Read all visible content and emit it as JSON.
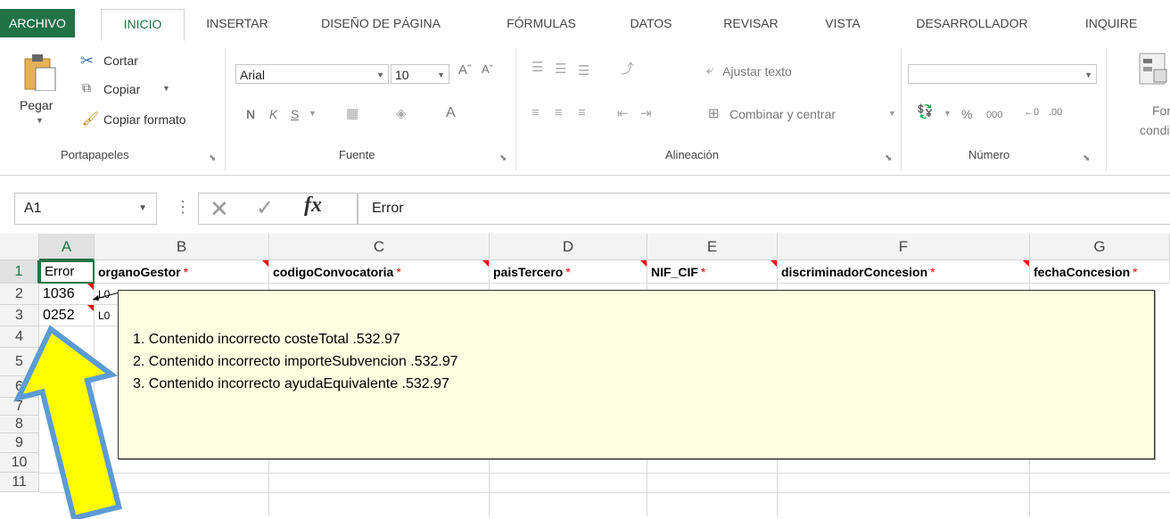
{
  "tabs": [
    "ARCHIVO",
    "INICIO",
    "INSERTAR",
    "DISEÑO DE PÁGINA",
    "FÓRMULAS",
    "DATOS",
    "REVISAR",
    "VISTA",
    "DESARROLLADOR",
    "INQUIRE"
  ],
  "clipboard": {
    "paste_label": "Pegar",
    "cut_label": "Cortar",
    "copy_label": "Copiar",
    "format_painter_label": "Copiar formato",
    "group_label": "Portapapeles"
  },
  "font": {
    "family_value": "Arial",
    "size_value": "10",
    "bold_label": "N",
    "italic_label": "K",
    "underline_label": "S",
    "group_label": "Fuente"
  },
  "alignment": {
    "wrap_text_label": "Ajustar texto",
    "merge_center_label": "Combinar y centrar",
    "group_label": "Alineación"
  },
  "number": {
    "format_value": "",
    "percent_label": "%",
    "thousands_label": "000",
    "group_label": "Número"
  },
  "styles": {
    "conditional_format_label_1": "Forma",
    "conditional_format_label_2": "condicio"
  },
  "formula_bar": {
    "name_box": "A1",
    "content": "Error"
  },
  "columns": [
    "A",
    "B",
    "C",
    "D",
    "E",
    "F",
    "G"
  ],
  "rows": [
    "1",
    "2",
    "3",
    "4",
    "5",
    "6",
    "7",
    "8",
    "9",
    "10",
    "11"
  ],
  "header_row": [
    "Error",
    "organoGestor",
    "codigoConvocatoria",
    "paisTercero",
    "NIF_CIF",
    "discriminadorConcesion",
    "fechaConcesion"
  ],
  "required_marker": "*",
  "data_rows": [
    [
      "1036",
      "L0"
    ],
    [
      "0252",
      "L0"
    ]
  ],
  "comment": {
    "lines": [
      "1. Contenido incorrecto costeTotal .532.97",
      "2. Contenido incorrecto importeSubvencion .532.97",
      "3. Contenido incorrecto ayudaEquivalente .532.97"
    ]
  },
  "colors": {
    "accent": "#217346",
    "comment_bg": "#ffffe1",
    "arrow_fill": "#ffff00",
    "arrow_stroke": "#5b9bd5",
    "required": "#e00000"
  }
}
